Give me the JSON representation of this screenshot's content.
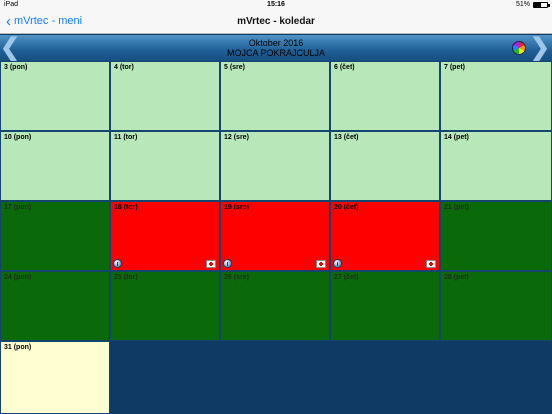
{
  "status": {
    "device": "iPad",
    "time": "15:16",
    "battery": "51%",
    "battery_level": 0.51
  },
  "nav": {
    "back_label": "mVrtec - meni",
    "title": "mVrtec - koledar"
  },
  "calendar": {
    "month": "Oktober 2016",
    "child_name": "MOJCA POKRAJCULJA",
    "prev_arrow": "❮",
    "next_arrow": "❯"
  },
  "days": [
    {
      "label": "3 (pon)",
      "status": "light"
    },
    {
      "label": "4 (tor)",
      "status": "light"
    },
    {
      "label": "5 (sre)",
      "status": "light"
    },
    {
      "label": "6 (čet)",
      "status": "light"
    },
    {
      "label": "7 (pet)",
      "status": "light"
    },
    {
      "label": "10 (pon)",
      "status": "light"
    },
    {
      "label": "11 (tor)",
      "status": "light"
    },
    {
      "label": "12 (sre)",
      "status": "light"
    },
    {
      "label": "13 (čet)",
      "status": "light"
    },
    {
      "label": "14 (pet)",
      "status": "light"
    },
    {
      "label": "17 (pon)",
      "status": "dark"
    },
    {
      "label": "18 (tor)",
      "status": "red",
      "icons": [
        "info-icon",
        "medkit-icon"
      ]
    },
    {
      "label": "19 (sre)",
      "status": "red",
      "icons": [
        "info-icon",
        "medkit-icon"
      ]
    },
    {
      "label": "20 (čet)",
      "status": "red",
      "icons": [
        "info-icon",
        "medkit-icon"
      ]
    },
    {
      "label": "21 (pet)",
      "status": "dark"
    },
    {
      "label": "24 (pon)",
      "status": "dark"
    },
    {
      "label": "25 (tor)",
      "status": "dark"
    },
    {
      "label": "26 (sre)",
      "status": "dark"
    },
    {
      "label": "27 (čet)",
      "status": "dark"
    },
    {
      "label": "28 (pet)",
      "status": "dark"
    },
    {
      "label": "31 (pon)",
      "status": "cream"
    }
  ],
  "colors": {
    "light": "#b8e8b9",
    "dark": "#0a6a0a",
    "red": "#ff0000",
    "cream": "#ffffd2",
    "accent": "#147efb"
  }
}
